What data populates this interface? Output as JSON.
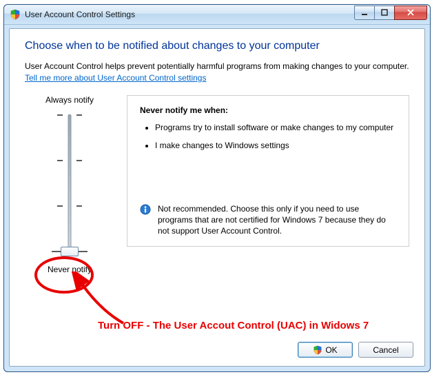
{
  "window": {
    "title": "User Account Control Settings"
  },
  "page": {
    "heading": "Choose when to be notified about changes to your computer",
    "intro": "User Account Control helps prevent potentially harmful programs from making changes to your computer.",
    "link": "Tell me more about User Account Control settings"
  },
  "slider": {
    "top_label": "Always notify",
    "bottom_label": "Never notify",
    "position": 3,
    "levels": 4
  },
  "description": {
    "title": "Never notify me when:",
    "bullets": [
      "Programs try to install software or make changes to my computer",
      "I make changes to Windows settings"
    ],
    "note": "Not recommended. Choose this only if you need to use programs that are not certified for Windows 7 because they do not support User Account Control."
  },
  "buttons": {
    "ok": "OK",
    "cancel": "Cancel"
  },
  "annotation": {
    "text": "Turn OFF - The User Accout Control (UAC) in Widows 7"
  }
}
